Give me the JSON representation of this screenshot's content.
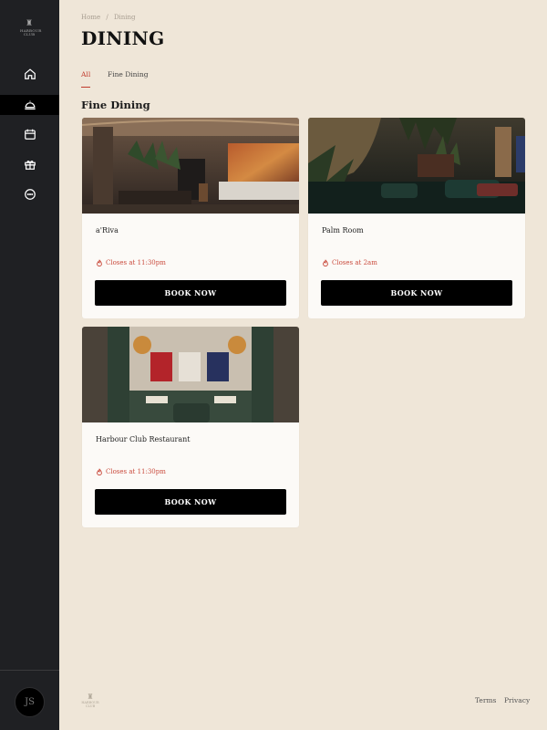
{
  "app": {
    "logo_text": "HARBOUR CLUB"
  },
  "sidebar": {
    "items": [
      {
        "name": "home",
        "icon": "home-icon"
      },
      {
        "name": "dining",
        "icon": "cloche-icon",
        "active": true
      },
      {
        "name": "calendar",
        "icon": "calendar-icon"
      },
      {
        "name": "gift",
        "icon": "gift-icon"
      },
      {
        "name": "chat",
        "icon": "chat-icon"
      }
    ],
    "avatar_initials": "JS"
  },
  "breadcrumb": {
    "home": "Home",
    "separator": "/",
    "current": "Dining"
  },
  "page": {
    "title": "DINING"
  },
  "tabs": [
    {
      "label": "All",
      "active": true
    },
    {
      "label": "Fine Dining",
      "active": false
    }
  ],
  "section": {
    "title": "Fine Dining"
  },
  "restaurants": [
    {
      "name": "a'Riva",
      "hours": "Closes at 11:30pm",
      "button": "BOOK NOW"
    },
    {
      "name": "Palm Room",
      "hours": "Closes at 2am",
      "button": "BOOK NOW"
    },
    {
      "name": "Harbour Club Restaurant",
      "hours": "Closes at 11:30pm",
      "button": "BOOK NOW"
    }
  ],
  "footer": {
    "terms": "Terms",
    "privacy": "Privacy"
  },
  "colors": {
    "background": "#efe6d8",
    "sidebar": "#1f2023",
    "accent": "#c0392b",
    "button": "#000000"
  }
}
